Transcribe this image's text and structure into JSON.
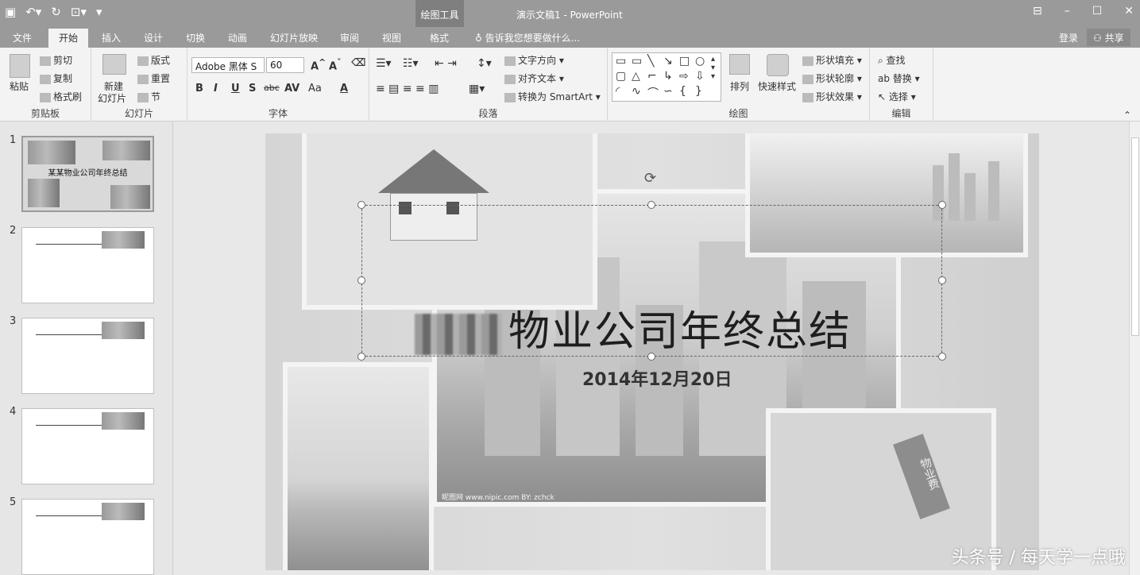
{
  "app": {
    "doc_title": "演示文稿1 - PowerPoint",
    "context_tools_label": "绘图工具",
    "quick_access": [
      "save-icon",
      "undo-icon",
      "repeat-icon",
      "present-icon"
    ]
  },
  "tabs": [
    {
      "label": "文件"
    },
    {
      "label": "开始",
      "active": true
    },
    {
      "label": "插入"
    },
    {
      "label": "设计"
    },
    {
      "label": "切换"
    },
    {
      "label": "动画"
    },
    {
      "label": "幻灯片放映"
    },
    {
      "label": "审阅"
    },
    {
      "label": "视图"
    },
    {
      "label": "格式"
    }
  ],
  "tell_me": "告诉我您想要做什么...",
  "account": {
    "login": "登录",
    "share": "共享"
  },
  "ribbon": {
    "clipboard": {
      "label": "剪贴板",
      "paste": "粘贴",
      "cut": "剪切",
      "copy": "复制",
      "format_painter": "格式刷"
    },
    "slides": {
      "label": "幻灯片",
      "new_slide_1": "新建",
      "new_slide_2": "幻灯片",
      "layout": "版式",
      "reset": "重置",
      "section": "节"
    },
    "font": {
      "label": "字体",
      "font_name": "Adobe 黑体 S",
      "font_size": "60",
      "bold": "B",
      "italic": "I",
      "underline": "U",
      "shadow": "S",
      "strike": "abc",
      "spacing": "AV",
      "case": "Aa",
      "color": "A"
    },
    "paragraph": {
      "label": "段落",
      "text_direction": "文字方向",
      "align_text": "对齐文本",
      "smartart": "转换为 SmartArt"
    },
    "drawing": {
      "label": "绘图",
      "arrange": "排列",
      "quick_styles": "快速样式",
      "shape_fill": "形状填充",
      "shape_outline": "形状轮廓",
      "shape_effects": "形状效果"
    },
    "editing": {
      "label": "编辑",
      "find": "查找",
      "replace": "替换",
      "select": "选择"
    }
  },
  "thumbnails": [
    {
      "num": "1",
      "title": "某某物业公司年终总结"
    },
    {
      "num": "2"
    },
    {
      "num": "3"
    },
    {
      "num": "4"
    },
    {
      "num": "5"
    }
  ],
  "slide": {
    "title_visible": "物业公司年终总结",
    "subtitle": "2014年12月20日",
    "photo_credit": "昵图网 www.nipic.com  BY: zchck",
    "tag_text": "物业费"
  },
  "watermark": "头条号 / 每天学一点哦"
}
